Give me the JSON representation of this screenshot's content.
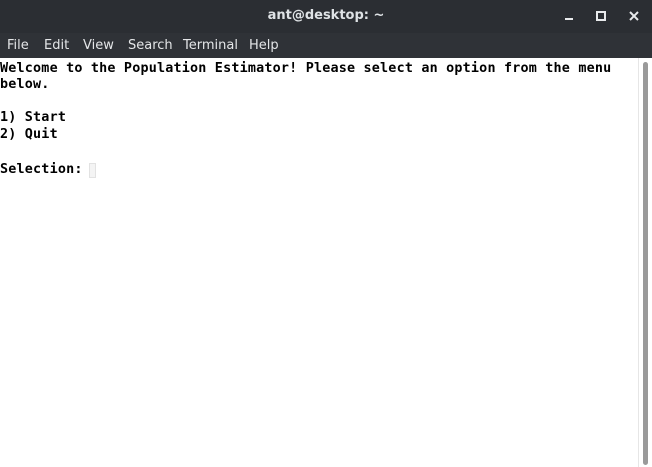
{
  "window": {
    "title": "ant@desktop: ~",
    "controls": {
      "minimize_icon": "minimize-icon",
      "maximize_icon": "maximize-icon",
      "close_icon": "close-icon"
    }
  },
  "menu": {
    "items": [
      "File",
      "Edit",
      "View",
      "Search",
      "Terminal",
      "Help"
    ]
  },
  "terminal": {
    "lines": [
      "Welcome to the Population Estimator! Please select an option from the menu",
      "below.",
      "1) Start",
      "2) Quit",
      "Selection: "
    ]
  },
  "colors": {
    "titlebar_bg": "#2b2e33",
    "menubar_bg": "#2f3237",
    "terminal_bg": "#ffffff",
    "terminal_fg": "#000000"
  }
}
